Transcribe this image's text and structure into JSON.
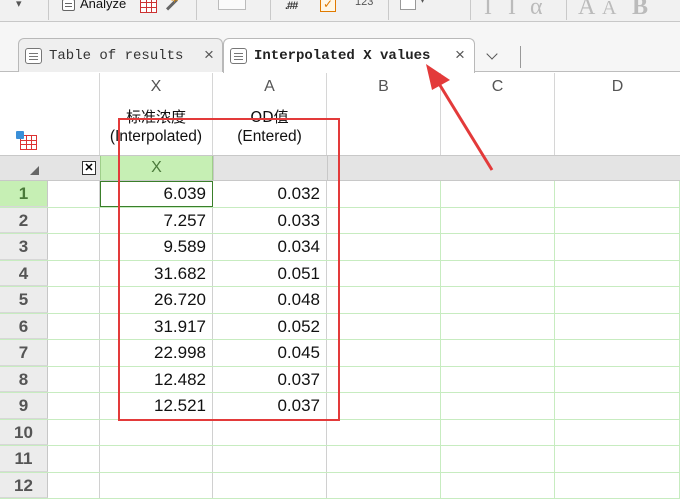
{
  "toolbar": {
    "analyze_label": "Analyze",
    "hash_label": "#",
    "hash_sup": ".##",
    "count_label": "123",
    "font_glyphs": [
      "A",
      "A",
      "B"
    ],
    "italic_glyphs": [
      "I",
      "I",
      "α"
    ]
  },
  "tabs": [
    {
      "label": "Table of results",
      "active": false
    },
    {
      "label": "Interpolated X values",
      "active": true
    }
  ],
  "columns": [
    {
      "letter": "X",
      "title_line1": "标准浓度",
      "title_line2": "(Interpolated)"
    },
    {
      "letter": "A",
      "title_line1": "OD值",
      "title_line2": "(Entered)"
    },
    {
      "letter": "B",
      "title_line1": "",
      "title_line2": ""
    },
    {
      "letter": "C",
      "title_line1": "",
      "title_line2": ""
    },
    {
      "letter": "D",
      "title_line1": "",
      "title_line2": ""
    }
  ],
  "subheader": {
    "x_label": "X",
    "checkbox": "✕"
  },
  "rows": [
    {
      "num": "1",
      "x": "6.039",
      "a": "0.032"
    },
    {
      "num": "2",
      "x": "7.257",
      "a": "0.033"
    },
    {
      "num": "3",
      "x": "9.589",
      "a": "0.034"
    },
    {
      "num": "4",
      "x": "31.682",
      "a": "0.051"
    },
    {
      "num": "5",
      "x": "26.720",
      "a": "0.048"
    },
    {
      "num": "6",
      "x": "31.917",
      "a": "0.052"
    },
    {
      "num": "7",
      "x": "22.998",
      "a": "0.045"
    },
    {
      "num": "8",
      "x": "12.482",
      "a": "0.037"
    },
    {
      "num": "9",
      "x": "12.521",
      "a": "0.037"
    },
    {
      "num": "10",
      "x": "",
      "a": ""
    },
    {
      "num": "11",
      "x": "",
      "a": ""
    },
    {
      "num": "12",
      "x": "",
      "a": ""
    }
  ],
  "colors": {
    "selection_green": "#c6efb4",
    "annotation_red": "#e33a3a",
    "grid_line": "#c7ecc0"
  }
}
